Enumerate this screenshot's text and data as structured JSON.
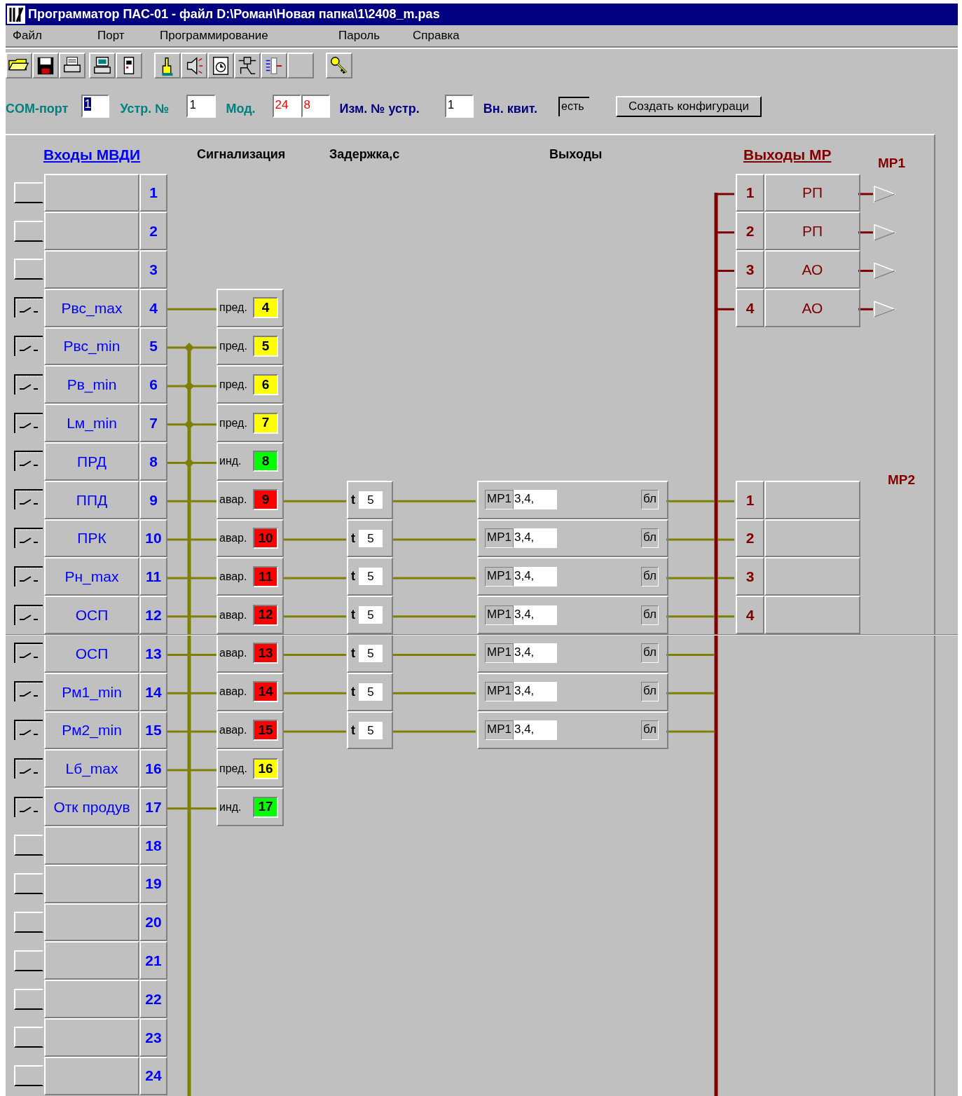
{
  "window": {
    "title": "Программатор ПАС-01 - файл D:\\Роман\\Новая папка\\1\\2408_m.pas"
  },
  "menu": [
    "Файл",
    "Порт",
    "Программирование",
    "Пароль",
    "Справка"
  ],
  "settings": {
    "com_port_label": "COM-порт",
    "com_port": "1",
    "device_label": "Устр. №",
    "device": "1",
    "mod_label": "Мод.",
    "mod": [
      "24",
      "8"
    ],
    "change_label": "Изм. № устр.",
    "change": "1",
    "ack_label": "Вн. квит.",
    "ack": "есть",
    "create_button": "Создать конфигураци"
  },
  "headers": {
    "inputs": "Входы МВДИ",
    "signalling": "Сигнализация",
    "delay": "Задержка,с",
    "outputs": "Выходы",
    "relay_outputs": "Выходы МР"
  },
  "rows": [
    {
      "number": "1",
      "switch": false
    },
    {
      "number": "2",
      "switch": false
    },
    {
      "number": "3",
      "switch": false
    },
    {
      "number": "4",
      "switch": true,
      "name": "Рвс_max",
      "junction": false,
      "signal": {
        "kind": "warning",
        "label": "пред.",
        "code": "4"
      }
    },
    {
      "number": "5",
      "switch": true,
      "name": "Рвс_min",
      "junction": true,
      "signal": {
        "kind": "warning",
        "label": "пред.",
        "code": "5"
      }
    },
    {
      "number": "6",
      "switch": true,
      "name": "Рв_min",
      "junction": true,
      "signal": {
        "kind": "warning",
        "label": "пред.",
        "code": "6"
      }
    },
    {
      "number": "7",
      "switch": true,
      "name": "Lм_min",
      "junction": true,
      "signal": {
        "kind": "warning",
        "label": "пред.",
        "code": "7"
      }
    },
    {
      "number": "8",
      "switch": true,
      "name": "ПРД",
      "junction": true,
      "signal": {
        "kind": "indication",
        "label": "инд.",
        "code": "8"
      }
    },
    {
      "number": "9",
      "switch": true,
      "name": "ППД",
      "junction": false,
      "signal": {
        "kind": "alarm",
        "label": "авар.",
        "code": "9"
      },
      "delay": {
        "label": "t",
        "value": "5"
      },
      "output": {
        "relay": "МР1",
        "value": "3,4,",
        "block": "бл"
      }
    },
    {
      "number": "10",
      "switch": true,
      "name": "ПРК",
      "junction": false,
      "signal": {
        "kind": "alarm",
        "label": "авар.",
        "code": "10"
      },
      "delay": {
        "label": "t",
        "value": "5"
      },
      "output": {
        "relay": "МР1",
        "value": "3,4,",
        "block": "бл"
      }
    },
    {
      "number": "11",
      "switch": true,
      "name": "Рн_max",
      "junction": false,
      "signal": {
        "kind": "alarm",
        "label": "авар.",
        "code": "11"
      },
      "delay": {
        "label": "t",
        "value": "5"
      },
      "output": {
        "relay": "МР1",
        "value": "3,4,",
        "block": "бл"
      }
    },
    {
      "number": "12",
      "switch": true,
      "name": "ОСП",
      "junction": false,
      "signal": {
        "kind": "alarm",
        "label": "авар.",
        "code": "12"
      },
      "delay": {
        "label": "t",
        "value": "5"
      },
      "output": {
        "relay": "МР1",
        "value": "3,4,",
        "block": "бл"
      }
    },
    {
      "number": "13",
      "switch": true,
      "name": "ОСП",
      "junction": false,
      "signal": {
        "kind": "alarm",
        "label": "авар.",
        "code": "13"
      },
      "delay": {
        "label": "t",
        "value": "5"
      },
      "output": {
        "relay": "МР1",
        "value": "3,4,",
        "block": "бл"
      }
    },
    {
      "number": "14",
      "switch": true,
      "name": "Рм1_min",
      "junction": false,
      "signal": {
        "kind": "alarm",
        "label": "авар.",
        "code": "14"
      },
      "delay": {
        "label": "t",
        "value": "5"
      },
      "output": {
        "relay": "МР1",
        "value": "3,4,",
        "block": "бл"
      }
    },
    {
      "number": "15",
      "switch": true,
      "name": "Рм2_min",
      "junction": false,
      "signal": {
        "kind": "alarm",
        "label": "авар.",
        "code": "15"
      },
      "delay": {
        "label": "t",
        "value": "5"
      },
      "output": {
        "relay": "МР1",
        "value": "3,4,",
        "block": "бл"
      }
    },
    {
      "number": "16",
      "switch": true,
      "name": "Lб_max",
      "junction": false,
      "signal": {
        "kind": "warning",
        "label": "пред.",
        "code": "16"
      }
    },
    {
      "number": "17",
      "switch": true,
      "name": "Отк продув",
      "junction": false,
      "signal": {
        "kind": "indication",
        "label": "инд.",
        "code": "17"
      }
    },
    {
      "number": "18",
      "switch": false
    },
    {
      "number": "19",
      "switch": false
    },
    {
      "number": "20",
      "switch": false
    },
    {
      "number": "21",
      "switch": false
    },
    {
      "number": "22",
      "switch": false
    },
    {
      "number": "23",
      "switch": false
    },
    {
      "number": "24",
      "switch": false
    }
  ],
  "relays": [
    {
      "label": "МР1",
      "outputs": [
        {
          "number": "1",
          "name": "РП",
          "arrow": true
        },
        {
          "number": "2",
          "name": "РП",
          "arrow": true
        },
        {
          "number": "3",
          "name": "АО",
          "arrow": true
        },
        {
          "number": "4",
          "name": "АО",
          "arrow": true
        }
      ]
    },
    {
      "label": "МР2",
      "outputs": [
        {
          "number": "1",
          "arrow": false
        },
        {
          "number": "2",
          "arrow": false
        },
        {
          "number": "3",
          "arrow": false
        },
        {
          "number": "4",
          "arrow": false
        }
      ]
    }
  ]
}
